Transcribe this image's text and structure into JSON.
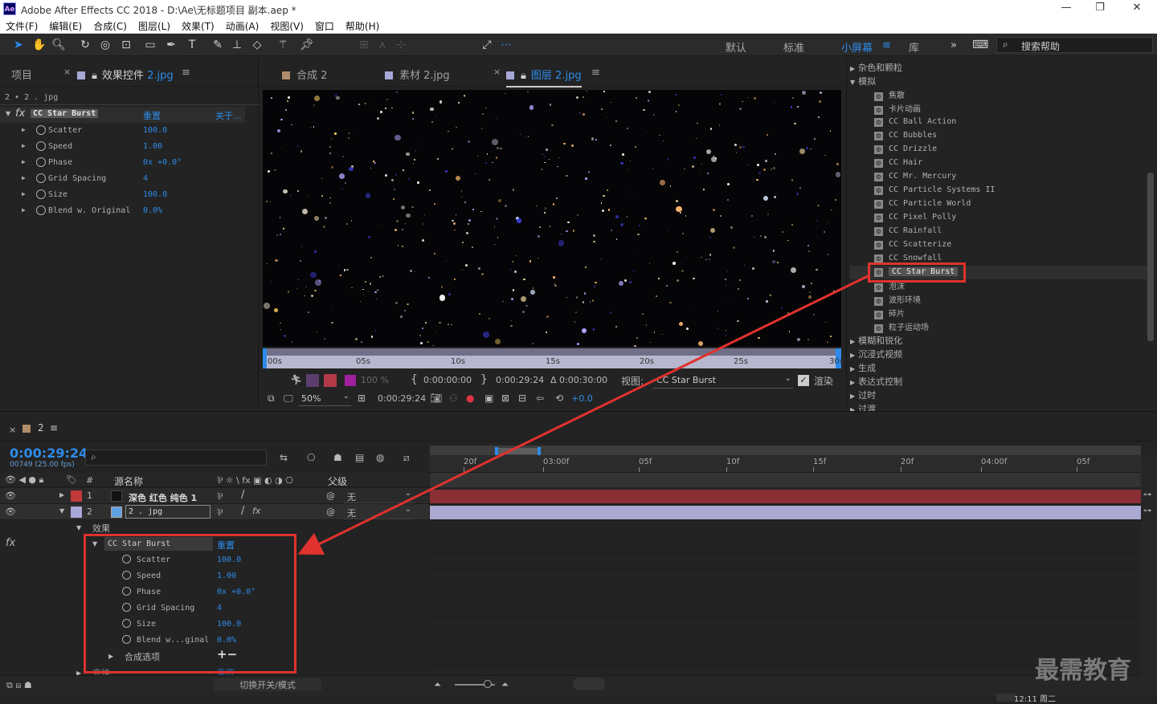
{
  "app": {
    "logo": "Ae",
    "title": "Adobe After Effects CC 2018 - D:\\Ae\\无标题项目 副本.aep *",
    "window_buttons": [
      "—",
      "❐",
      "✕"
    ]
  },
  "menu": [
    "文件(F)",
    "编辑(E)",
    "合成(C)",
    "图层(L)",
    "效果(T)",
    "动画(A)",
    "视图(V)",
    "窗口",
    "帮助(H)"
  ],
  "toolbar": {
    "align_label": "对齐",
    "workspaces": [
      "默认",
      "标准",
      "小屏幕",
      "库"
    ],
    "active_workspace": "小屏幕",
    "more": "»",
    "search_help": "搜索帮助"
  },
  "left_panel": {
    "tabs": [
      "项目",
      "效果控件 2.jpg"
    ],
    "tab_close": "×",
    "effect_controls_prefix": "效果控件",
    "effect_controls_file": "2.jpg",
    "menu_icon": "≡",
    "breadcrumb": "2 • 2 . jpg",
    "effect_name": "CC Star Burst",
    "reset": "重置",
    "about": "关于...",
    "properties": [
      {
        "name": "Scatter",
        "value": "100.0"
      },
      {
        "name": "Speed",
        "value": "1.00"
      },
      {
        "name": "Phase",
        "value": "0x +0.0°"
      },
      {
        "name": "Grid Spacing",
        "value": "4"
      },
      {
        "name": "Size",
        "value": "100.0"
      },
      {
        "name": "Blend w. Original",
        "value": "0.0%"
      }
    ]
  },
  "viewer": {
    "tabs": [
      "合成 2",
      "素材 2.jpg",
      "图层 2.jpg"
    ],
    "active_tab": "图层 2.jpg",
    "tab_close": "×",
    "menu_icon": "≡",
    "ruler_ticks": [
      "00s",
      "05s",
      "10s",
      "15s",
      "20s",
      "25s",
      "30s"
    ],
    "controls": {
      "percent": "100 %",
      "in_time": "0:00:00:00",
      "out_time": "0:00:29:24",
      "duration": "Δ 0:00:30:00",
      "view_label": "视图:",
      "view_value": "CC Star Burst",
      "render_label": "渲染",
      "zoom": "50%",
      "current_time": "0:00:29:24",
      "exposure": "+0.0"
    }
  },
  "effects_panel": {
    "items": [
      {
        "label": "杂色和颗粒",
        "type": "category",
        "collapsed": true
      },
      {
        "label": "模拟",
        "type": "category",
        "collapsed": false
      },
      {
        "label": "焦散",
        "type": "effect"
      },
      {
        "label": "卡片动画",
        "type": "effect"
      },
      {
        "label": "CC Ball Action",
        "type": "effect"
      },
      {
        "label": "CC Bubbles",
        "type": "effect"
      },
      {
        "label": "CC Drizzle",
        "type": "effect"
      },
      {
        "label": "CC Hair",
        "type": "effect"
      },
      {
        "label": "CC Mr. Mercury",
        "type": "effect"
      },
      {
        "label": "CC Particle Systems II",
        "type": "effect"
      },
      {
        "label": "CC Particle World",
        "type": "effect"
      },
      {
        "label": "CC Pixel Polly",
        "type": "effect"
      },
      {
        "label": "CC Rainfall",
        "type": "effect"
      },
      {
        "label": "CC Scatterize",
        "type": "effect"
      },
      {
        "label": "CC Snowfall",
        "type": "effect"
      },
      {
        "label": "CC Star Burst",
        "type": "effect",
        "selected": true
      },
      {
        "label": "泡沫",
        "type": "effect"
      },
      {
        "label": "波形环境",
        "type": "effect"
      },
      {
        "label": "碎片",
        "type": "effect"
      },
      {
        "label": "粒子运动场",
        "type": "effect"
      },
      {
        "label": "模糊和锐化",
        "type": "category",
        "collapsed": true
      },
      {
        "label": "沉浸式视频",
        "type": "category",
        "collapsed": true
      },
      {
        "label": "生成",
        "type": "category",
        "collapsed": true
      },
      {
        "label": "表达式控制",
        "type": "category",
        "collapsed": true
      },
      {
        "label": "过时",
        "type": "category",
        "collapsed": true
      },
      {
        "label": "过渡",
        "type": "category",
        "collapsed": true
      }
    ]
  },
  "timeline": {
    "tab_close": "×",
    "comp_name": "2",
    "menu_icon": "≡",
    "timecode": "0:00:29:24",
    "frames": "00749 (25.00 fps)",
    "col_hash": "#",
    "col_source": "源名称",
    "col_parent": "父级",
    "layers": [
      {
        "num": "1",
        "name": "深色 红色 纯色 1",
        "parent": "无",
        "color": "#c2393b"
      },
      {
        "num": "2",
        "name": "2 . jpg",
        "parent": "无",
        "color": "#a8a8d8"
      }
    ],
    "effects_label": "效果",
    "fx_label": "fx",
    "effect_name": "CC Star Burst",
    "reset": "重置",
    "properties": [
      {
        "name": "Scatter",
        "value": "100.0"
      },
      {
        "name": "Speed",
        "value": "1.00"
      },
      {
        "name": "Phase",
        "value": "0x +0.0°"
      },
      {
        "name": "Grid Spacing",
        "value": "4"
      },
      {
        "name": "Size",
        "value": "100.0"
      },
      {
        "name": "Blend w...ginal",
        "value": "0.0%"
      }
    ],
    "composite_options": "合成选项",
    "composite_options_controls": "+−",
    "transform_label": "变换",
    "transform_reset": "重置",
    "toggle_modes": "切换开关/模式",
    "ruler_labels": [
      "20f",
      "03:00f",
      "05f",
      "10f",
      "15f",
      "20f",
      "04:00f",
      "05f"
    ],
    "status_time": "12:11 周二"
  },
  "watermark": "最需教育",
  "colors": {
    "accent": "#2d8ceb",
    "highlight_box": "#e0322e",
    "layer1_bar": "#8a2f35",
    "layer2_bar": "#a9a9d1"
  }
}
